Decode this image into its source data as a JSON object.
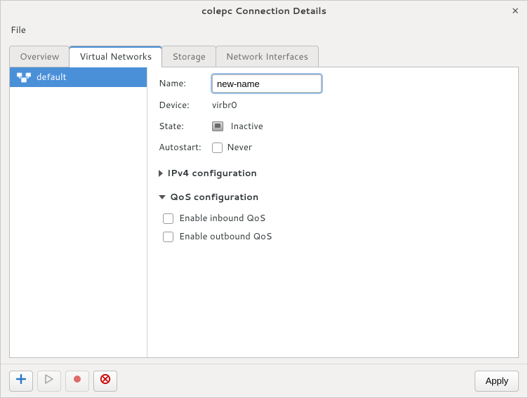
{
  "window": {
    "title": "colepc Connection Details"
  },
  "menubar": {
    "file": "File"
  },
  "tabs": {
    "overview": "Overview",
    "virtual_networks": "Virtual Networks",
    "storage": "Storage",
    "network_interfaces": "Network Interfaces",
    "active": "virtual_networks"
  },
  "sidebar": {
    "items": [
      {
        "id": "default",
        "label": "default",
        "selected": true
      }
    ]
  },
  "details": {
    "name_label": "Name:",
    "name_value": "new-name",
    "device_label": "Device:",
    "device_value": "virbr0",
    "state_label": "State:",
    "state_value": "Inactive",
    "autostart_label": "Autostart:",
    "autostart_value": "Never",
    "autostart_checked": false,
    "ipv4_expander": "IPv4 configuration",
    "ipv4_expanded": false,
    "qos_expander": "QoS configuration",
    "qos_expanded": true,
    "qos_inbound_label": "Enable inbound QoS",
    "qos_inbound_checked": false,
    "qos_outbound_label": "Enable outbound QoS",
    "qos_outbound_checked": false
  },
  "bottombar": {
    "apply_label": "Apply"
  },
  "icons": {
    "add": "plus-icon",
    "start": "play-icon",
    "stop": "record-icon",
    "delete": "cancel-icon"
  }
}
